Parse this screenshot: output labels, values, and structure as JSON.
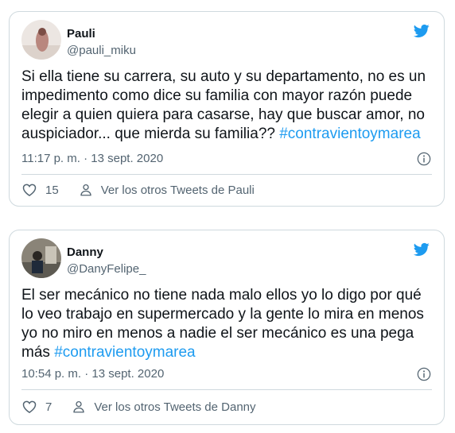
{
  "accent_color": "#1d9bf0",
  "tweets": [
    {
      "name": "Pauli",
      "handle": "@pauli_miku",
      "text": "Si ella tiene su carrera, su auto y su departamento, no es un impedimento como dice su familia con mayor razón puede elegir a quien quiera para casarse, hay que buscar amor, no auspiciador... que mierda su familia?? ",
      "hashtag": "#contravientoymarea",
      "timestamp": "11:17 p. m. · 13 sept. 2020",
      "likes": "15",
      "others_link": "Ver los otros Tweets de Pauli",
      "icons": [
        "twitter-bird-icon",
        "info-icon",
        "heart-icon",
        "person-icon"
      ]
    },
    {
      "name": "Danny",
      "handle": "@DanyFelipe_",
      "text": "El ser mecánico no tiene nada malo ellos yo lo digo por qué lo veo trabajo en supermercado y la gente lo mira en menos yo no miro en menos a nadie el ser mecánico es una pega más ",
      "hashtag": "#contravientoymarea",
      "timestamp": "10:54 p. m. · 13 sept. 2020",
      "likes": "7",
      "others_link": "Ver los otros Tweets de Danny",
      "icons": [
        "twitter-bird-icon",
        "info-icon",
        "heart-icon",
        "person-icon"
      ]
    }
  ]
}
